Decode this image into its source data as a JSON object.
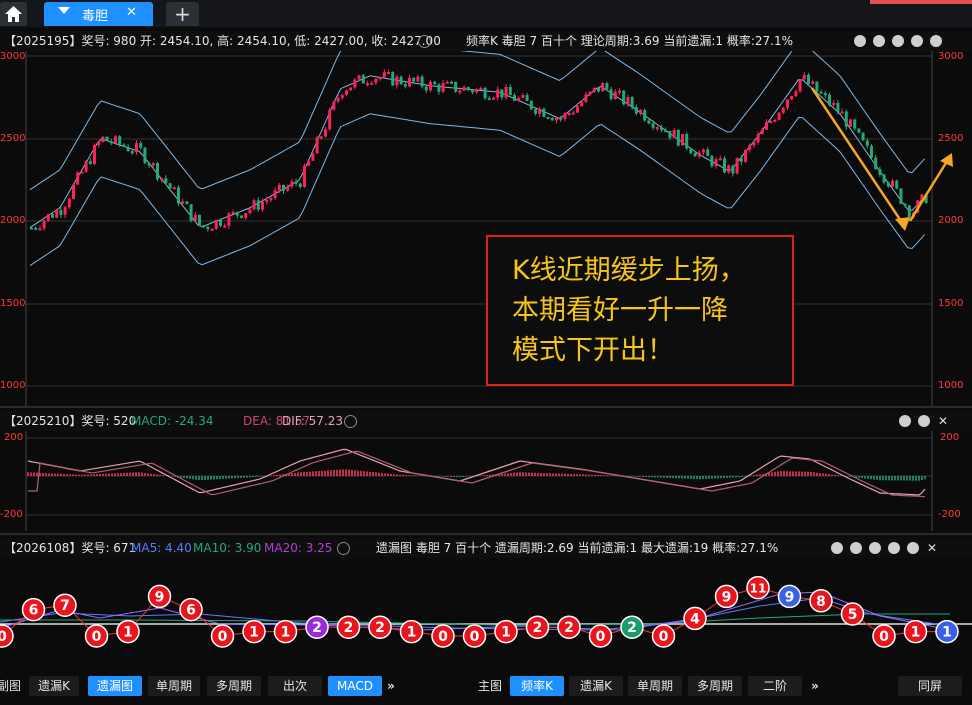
{
  "tabs": {
    "active": "毒胆",
    "close": "✕",
    "add": "+"
  },
  "pane1": {
    "header": {
      "left": "【2025195】奖号: 980  开: 2454.10, 高: 2454.10, 低: 2427.00, 收: 2427.00",
      "mid": "频率K  毒胆  7  百十个  理论周期:3.69  当前遗漏:1  概率:27.1%"
    },
    "yticks_left": [
      "3000",
      "2500",
      "2000",
      "1500",
      "1000"
    ],
    "yticks_right": [
      "3000",
      "2500",
      "2000",
      "1500",
      "1000"
    ],
    "annotation": [
      "K线近期缓步上扬，",
      "本期看好一升一降",
      "模式下开出！"
    ]
  },
  "pane2": {
    "header": {
      "prefix": "【2025210】奖号: 520",
      "macd": "MACD: -24.34",
      "dea": "DEA: 81.57",
      "dif": "DIF: 57.23"
    },
    "yticks_left": [
      "200",
      "-200"
    ],
    "yticks_right": [
      "200",
      "-200"
    ]
  },
  "pane3": {
    "header": {
      "prefix": "【2026108】奖号: 671",
      "ma5": "MA5: 4.40",
      "ma10": "MA10: 3.90",
      "ma20": "MA20: 3.25",
      "mid": "遗漏图  毒胆  7  百十个  遗漏周期:2.69  当前遗漏:1  最大遗漏:19  概率:27.1%"
    },
    "balls": [
      {
        "v": "0",
        "c": "#e8141e"
      },
      {
        "v": "6",
        "c": "#e8141e"
      },
      {
        "v": "7",
        "c": "#e8141e"
      },
      {
        "v": "0",
        "c": "#e8141e"
      },
      {
        "v": "1",
        "c": "#e8141e"
      },
      {
        "v": "9",
        "c": "#e8141e"
      },
      {
        "v": "6",
        "c": "#e8141e"
      },
      {
        "v": "0",
        "c": "#e8141e"
      },
      {
        "v": "1",
        "c": "#e8141e"
      },
      {
        "v": "1",
        "c": "#e8141e"
      },
      {
        "v": "2",
        "c": "#9b2bd8"
      },
      {
        "v": "2",
        "c": "#e8141e"
      },
      {
        "v": "2",
        "c": "#e8141e"
      },
      {
        "v": "1",
        "c": "#e8141e"
      },
      {
        "v": "0",
        "c": "#e8141e"
      },
      {
        "v": "0",
        "c": "#e8141e"
      },
      {
        "v": "1",
        "c": "#e8141e"
      },
      {
        "v": "2",
        "c": "#e8141e"
      },
      {
        "v": "2",
        "c": "#e8141e"
      },
      {
        "v": "0",
        "c": "#e8141e"
      },
      {
        "v": "2",
        "c": "#1f9a6a"
      },
      {
        "v": "0",
        "c": "#e8141e"
      },
      {
        "v": "4",
        "c": "#e8141e"
      },
      {
        "v": "9",
        "c": "#e8141e"
      },
      {
        "v": "11",
        "c": "#e8141e"
      },
      {
        "v": "9",
        "c": "#3a5fe8"
      },
      {
        "v": "8",
        "c": "#e8141e"
      },
      {
        "v": "5",
        "c": "#e8141e"
      },
      {
        "v": "0",
        "c": "#e8141e"
      },
      {
        "v": "1",
        "c": "#e8141e"
      },
      {
        "v": "1",
        "c": "#3a5fe8"
      }
    ]
  },
  "bottombar": {
    "left": [
      "副图",
      "遗漏K",
      "遗漏图",
      "单周期",
      "多周期",
      "出次",
      "MACD"
    ],
    "left_active": [
      "遗漏图",
      "MACD"
    ],
    "more": "»",
    "right": [
      "主图",
      "频率K",
      "遗漏K",
      "单周期",
      "多周期",
      "二阶"
    ],
    "right_active": [
      "频率K"
    ],
    "more2": "»",
    "sync": "同屏"
  },
  "colors": {
    "up": "#ff2255",
    "down": "#22aa77",
    "band": "#7fb8e8",
    "arrow": "#f5a623",
    "annot_border": "#e0201a",
    "annot_text": "#f5c518"
  }
}
